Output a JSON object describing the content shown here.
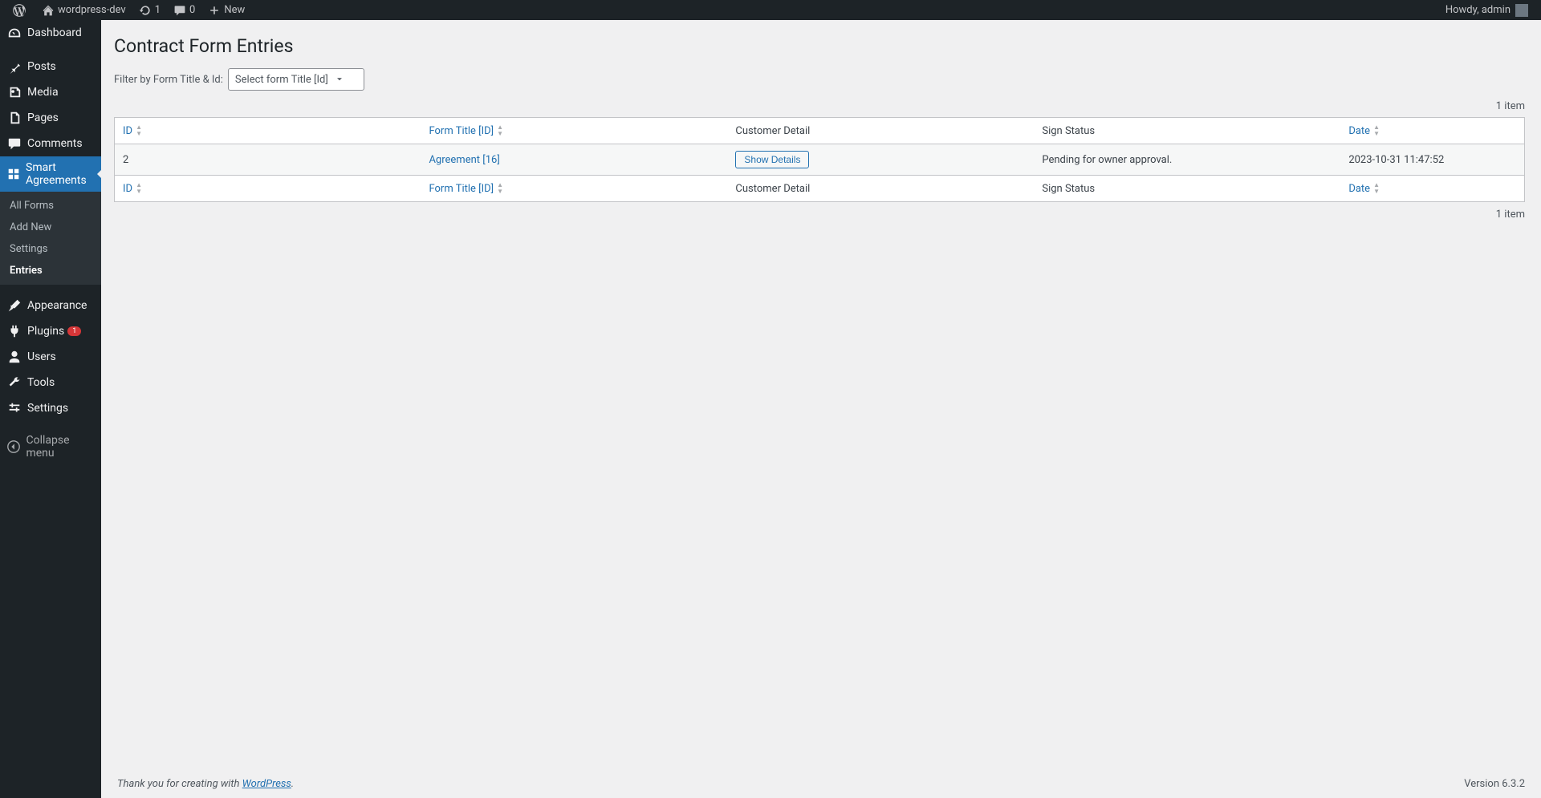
{
  "adminbar": {
    "site_name": "wordpress-dev",
    "updates_count": "1",
    "comments_count": "0",
    "new_label": "New",
    "greeting": "Howdy, admin"
  },
  "sidebar": {
    "items": [
      {
        "id": "dashboard",
        "label": "Dashboard"
      },
      {
        "id": "posts",
        "label": "Posts"
      },
      {
        "id": "media",
        "label": "Media"
      },
      {
        "id": "pages",
        "label": "Pages"
      },
      {
        "id": "comments",
        "label": "Comments"
      },
      {
        "id": "smart-agreements",
        "label": "Smart Agreements"
      },
      {
        "id": "appearance",
        "label": "Appearance"
      },
      {
        "id": "plugins",
        "label": "Plugins",
        "badge": "1"
      },
      {
        "id": "users",
        "label": "Users"
      },
      {
        "id": "tools",
        "label": "Tools"
      },
      {
        "id": "settings",
        "label": "Settings"
      },
      {
        "id": "collapse",
        "label": "Collapse menu"
      }
    ],
    "submenu": [
      {
        "label": "All Forms"
      },
      {
        "label": "Add New"
      },
      {
        "label": "Settings"
      },
      {
        "label": "Entries"
      }
    ]
  },
  "main": {
    "page_title": "Contract Form Entries",
    "filter_label": "Filter by Form Title & Id:",
    "filter_selected": "Select form Title [Id]",
    "item_count_top": "1 item",
    "item_count_bottom": "1 item",
    "columns": {
      "id": "ID",
      "form_title": "Form Title [ID]",
      "customer": "Customer Detail",
      "sign_status": "Sign Status",
      "date": "Date"
    },
    "rows": [
      {
        "id": "2",
        "form_title": "Agreement [16]",
        "show_details": "Show Details",
        "sign_status": "Pending for owner approval.",
        "date": "2023-10-31 11:47:52"
      }
    ]
  },
  "footer": {
    "thanks_prefix": "Thank you for creating with ",
    "wordpress": "WordPress",
    "period": ".",
    "version": "Version 6.3.2"
  }
}
